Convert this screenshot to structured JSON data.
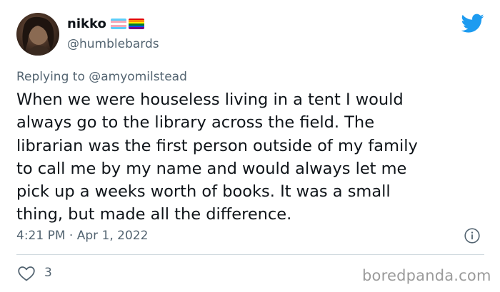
{
  "author": {
    "display_name": "nikko",
    "handle": "@humblebards",
    "flag_icons": [
      "transgender-flag-icon",
      "rainbow-flag-icon"
    ]
  },
  "reply": {
    "label": "Replying to ",
    "mention": "@amyomilstead"
  },
  "tweet": {
    "text": "When we were houseless living in a tent I would\nalways go to the library across the field. The\nlibrarian was the first person outside of my family\nto call me by my name and would always let me\npick up a weeks worth of books. It was a small\nthing, but made all the difference."
  },
  "meta": {
    "timestamp": "4:21 PM · Apr 1, 2022"
  },
  "engagement": {
    "likes": "3"
  },
  "watermark": "boredpanda.com",
  "colors": {
    "twitter_blue": "#1d9bf0",
    "secondary_text": "#536471",
    "divider": "#cfd9de"
  }
}
